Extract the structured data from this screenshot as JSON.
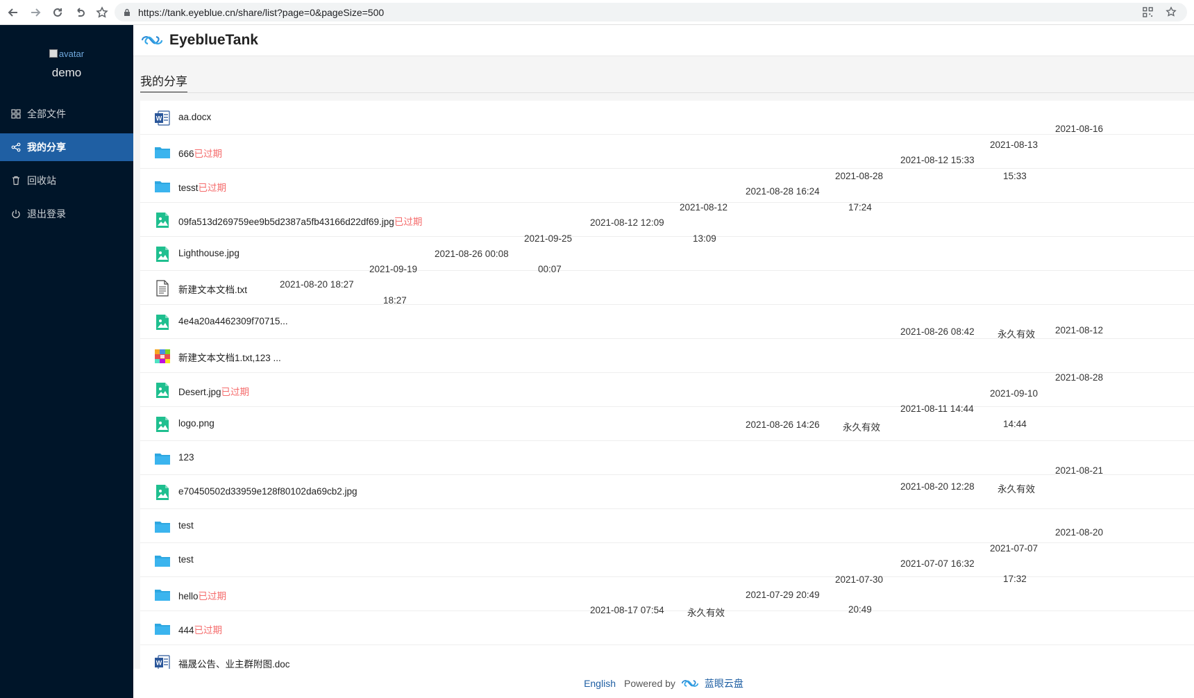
{
  "browser": {
    "url": "https://tank.eyeblue.cn/share/list?page=0&pageSize=500"
  },
  "sidebar": {
    "avatar_alt": "avatar",
    "username": "demo",
    "items": [
      {
        "label": "全部文件",
        "icon": "grid-icon"
      },
      {
        "label": "我的分享",
        "icon": "share-icon",
        "active": true
      },
      {
        "label": "回收站",
        "icon": "trash-icon"
      },
      {
        "label": "退出登录",
        "icon": "power-icon"
      }
    ]
  },
  "header": {
    "brand": "EyeblueTank"
  },
  "main": {
    "title": "我的分享",
    "expired_label": "已过期",
    "rows": [
      {
        "name": "aa.docx",
        "type": "word",
        "expired": false
      },
      {
        "name": "666",
        "type": "folder",
        "expired": true
      },
      {
        "name": "tesst",
        "type": "folder",
        "expired": true
      },
      {
        "name": "09fa513d269759ee9b5d2387a5fb43166d22df69.jpg",
        "type": "image",
        "expired": true
      },
      {
        "name": "Lighthouse.jpg",
        "type": "image",
        "expired": false
      },
      {
        "name": "新建文本文档.txt",
        "type": "text",
        "expired": false
      },
      {
        "name": "4e4a20a4462309f70715...",
        "type": "image",
        "expired": false
      },
      {
        "name": "新建文本文档1.txt,123 ...",
        "type": "archive",
        "expired": false
      },
      {
        "name": "Desert.jpg",
        "type": "image",
        "expired": true
      },
      {
        "name": "logo.png",
        "type": "image",
        "expired": false
      },
      {
        "name": "123",
        "type": "folder",
        "expired": false
      },
      {
        "name": "e70450502d33959e128f80102da69cb2.jpg",
        "type": "image",
        "expired": false
      },
      {
        "name": "test",
        "type": "folder",
        "expired": false
      },
      {
        "name": "test",
        "type": "folder",
        "expired": false
      },
      {
        "name": "hello",
        "type": "folder",
        "expired": true
      },
      {
        "name": "444",
        "type": "folder",
        "expired": true
      },
      {
        "name": "福晟公告、业主群附图.doc",
        "type": "word",
        "expired": false
      }
    ],
    "scattered_cells": [
      {
        "text": "2021-08-16"
      },
      {
        "text": "2021-08-13"
      },
      {
        "text": "2021-08-12 15:33"
      },
      {
        "text": "2021-08-28"
      },
      {
        "text": "15:33"
      },
      {
        "text": "2021-08-28 16:24"
      },
      {
        "text": "2021-08-12"
      },
      {
        "text": "17:24"
      },
      {
        "text": "2021-08-12 12:09"
      },
      {
        "text": "2021-09-25"
      },
      {
        "text": "13:09"
      },
      {
        "text": "2021-08-26 00:08"
      },
      {
        "text": "2021-09-19"
      },
      {
        "text": "00:07"
      },
      {
        "text": "2021-08-20 18:27"
      },
      {
        "text": "18:27"
      },
      {
        "text": "2021-08-26 08:42"
      },
      {
        "text": "永久有效"
      },
      {
        "text": "2021-08-12"
      },
      {
        "text": "2021-08-28"
      },
      {
        "text": "2021-09-10"
      },
      {
        "text": "2021-08-11 14:44"
      },
      {
        "text": "2021-08-26 14:26"
      },
      {
        "text": "永久有效"
      },
      {
        "text": "14:44"
      },
      {
        "text": "2021-08-21"
      },
      {
        "text": "2021-08-20 12:28"
      },
      {
        "text": "永久有效"
      },
      {
        "text": "2021-08-20"
      },
      {
        "text": "2021-07-07"
      },
      {
        "text": "2021-07-07 16:32"
      },
      {
        "text": "2021-07-30"
      },
      {
        "text": "17:32"
      },
      {
        "text": "2021-07-29 20:49"
      },
      {
        "text": "2021-08-17 07:54"
      },
      {
        "text": "永久有效"
      },
      {
        "text": "20:49"
      }
    ]
  },
  "footer": {
    "language": "English",
    "powered_by": "Powered by",
    "brand_cn": "蓝眼云盘"
  }
}
